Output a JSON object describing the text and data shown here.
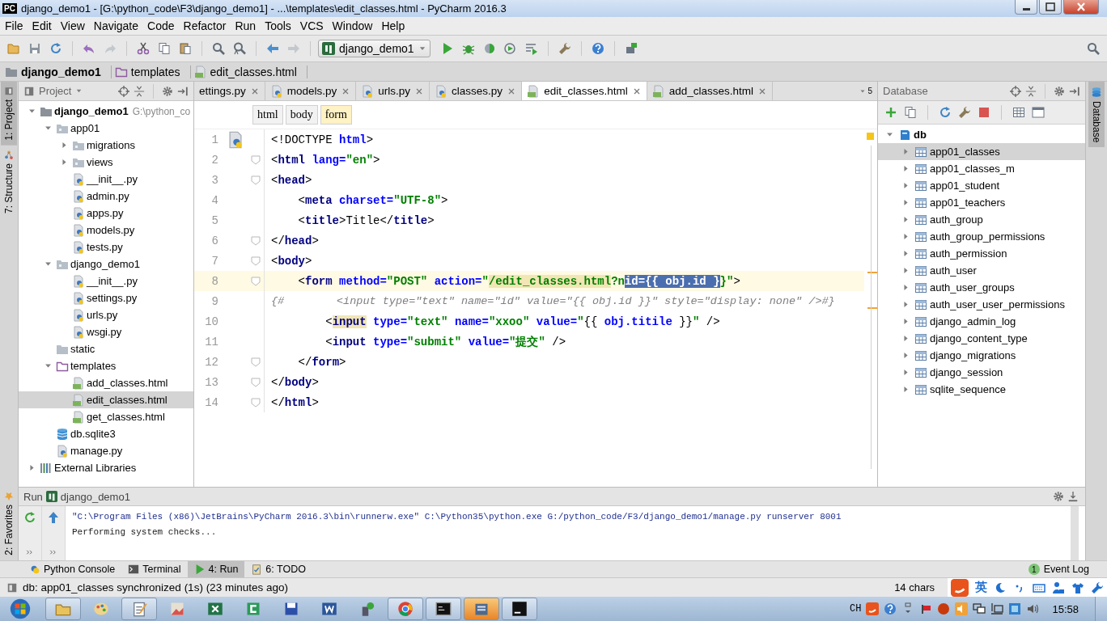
{
  "window": {
    "title": "django_demo1 - [G:\\python_code\\F3\\django_demo1] - ...\\templates\\edit_classes.html - PyCharm 2016.3",
    "app_badge": "PC"
  },
  "menu": [
    "File",
    "Edit",
    "View",
    "Navigate",
    "Code",
    "Refactor",
    "Run",
    "Tools",
    "VCS",
    "Window",
    "Help"
  ],
  "toolbar": {
    "run_config": "django_demo1"
  },
  "breadcrumb": [
    {
      "label": "django_demo1",
      "kind": "project"
    },
    {
      "label": "templates",
      "kind": "tfolder"
    },
    {
      "label": "edit_classes.html",
      "kind": "html"
    }
  ],
  "side_tabs_left": [
    {
      "label": "1: Project",
      "kind": "project",
      "selected": true
    },
    {
      "label": "7: Structure",
      "kind": "structure",
      "selected": false
    }
  ],
  "favorites_tab": "2: Favorites",
  "project_panel": {
    "title": "Project",
    "tree": [
      {
        "label": "django_demo1",
        "kind": "project",
        "path": "G:\\python_co",
        "expanded": true,
        "selected": false,
        "children": [
          {
            "label": "app01",
            "kind": "package",
            "expanded": true,
            "selected": false,
            "children": [
              {
                "label": "migrations",
                "kind": "package",
                "expanded": false,
                "selected": false
              },
              {
                "label": "views",
                "kind": "package",
                "expanded": false,
                "selected": false
              },
              {
                "label": "__init__.py",
                "kind": "python",
                "selected": false
              },
              {
                "label": "admin.py",
                "kind": "python",
                "selected": false
              },
              {
                "label": "apps.py",
                "kind": "python",
                "selected": false
              },
              {
                "label": "models.py",
                "kind": "python",
                "selected": false
              },
              {
                "label": "tests.py",
                "kind": "python",
                "selected": false
              }
            ]
          },
          {
            "label": "django_demo1",
            "kind": "package",
            "expanded": true,
            "selected": false,
            "children": [
              {
                "label": "__init__.py",
                "kind": "python",
                "selected": false
              },
              {
                "label": "settings.py",
                "kind": "python",
                "selected": false
              },
              {
                "label": "urls.py",
                "kind": "python",
                "selected": false
              },
              {
                "label": "wsgi.py",
                "kind": "python",
                "selected": false
              }
            ]
          },
          {
            "label": "static",
            "kind": "folder",
            "selected": false
          },
          {
            "label": "templates",
            "kind": "tfolder",
            "expanded": true,
            "selected": false,
            "children": [
              {
                "label": "add_classes.html",
                "kind": "html",
                "selected": false
              },
              {
                "label": "edit_classes.html",
                "kind": "html",
                "selected": true
              },
              {
                "label": "get_classes.html",
                "kind": "html",
                "selected": false
              }
            ]
          },
          {
            "label": "db.sqlite3",
            "kind": "db",
            "selected": false
          },
          {
            "label": "manage.py",
            "kind": "python",
            "selected": false
          }
        ]
      },
      {
        "label": "External Libraries",
        "kind": "library",
        "expanded": false,
        "selected": false
      }
    ]
  },
  "editor_tabs": [
    {
      "label": "ettings.py",
      "selected": false
    },
    {
      "label": "models.py",
      "kind": "python",
      "selected": false
    },
    {
      "label": "urls.py",
      "kind": "python",
      "selected": false
    },
    {
      "label": "classes.py",
      "kind": "python",
      "selected": false
    },
    {
      "label": "edit_classes.html",
      "kind": "html",
      "selected": true
    },
    {
      "label": "add_classes.html",
      "kind": "html",
      "selected": false
    }
  ],
  "tab_count": "5",
  "tag_path": [
    {
      "label": "html",
      "selected": false
    },
    {
      "label": "body",
      "selected": false
    },
    {
      "label": "form",
      "selected": true
    }
  ],
  "code": [
    {
      "num": "1",
      "kind": "icon",
      "fold": false,
      "current": false,
      "segments": [
        {
          "text": "<!DOCTYPE ",
          "kind": "text"
        },
        {
          "text": "html",
          "kind": "attr"
        },
        {
          "text": ">",
          "kind": "text"
        }
      ]
    },
    {
      "num": "2",
      "fold": true,
      "current": false,
      "segments": [
        {
          "text": "<",
          "kind": "text"
        },
        {
          "text": "html",
          "kind": "tag"
        },
        {
          "text": " lang=",
          "kind": "attr"
        },
        {
          "text": "\"en\"",
          "kind": "str"
        },
        {
          "text": ">",
          "kind": "text"
        }
      ]
    },
    {
      "num": "3",
      "fold": true,
      "current": false,
      "segments": [
        {
          "text": "<",
          "kind": "text"
        },
        {
          "text": "head",
          "kind": "tag"
        },
        {
          "text": ">",
          "kind": "text"
        }
      ]
    },
    {
      "num": "4",
      "fold": false,
      "current": false,
      "segments": [
        {
          "text": "    <",
          "kind": "text"
        },
        {
          "text": "meta",
          "kind": "tag"
        },
        {
          "text": " charset=",
          "kind": "attr"
        },
        {
          "text": "\"UTF-8\"",
          "kind": "str"
        },
        {
          "text": ">",
          "kind": "text"
        }
      ]
    },
    {
      "num": "5",
      "fold": false,
      "current": false,
      "segments": [
        {
          "text": "    <",
          "kind": "text"
        },
        {
          "text": "title",
          "kind": "tag"
        },
        {
          "text": ">Title</",
          "kind": "text"
        },
        {
          "text": "title",
          "kind": "tag"
        },
        {
          "text": ">",
          "kind": "text"
        }
      ]
    },
    {
      "num": "6",
      "fold": true,
      "current": false,
      "segments": [
        {
          "text": "</",
          "kind": "text"
        },
        {
          "text": "head",
          "kind": "tag"
        },
        {
          "text": ">",
          "kind": "text"
        }
      ]
    },
    {
      "num": "7",
      "fold": true,
      "current": false,
      "segments": [
        {
          "text": "<",
          "kind": "text"
        },
        {
          "text": "body",
          "kind": "tag"
        },
        {
          "text": ">",
          "kind": "text"
        }
      ]
    },
    {
      "num": "8",
      "fold": true,
      "current": true,
      "segments": [
        {
          "text": "    <",
          "kind": "text"
        },
        {
          "text": "form",
          "kind": "tag"
        },
        {
          "text": " method=",
          "kind": "attr"
        },
        {
          "text": "\"POST\"",
          "kind": "str"
        },
        {
          "text": " action=",
          "kind": "attr"
        },
        {
          "text": "\"",
          "kind": "str"
        },
        {
          "text": "/edit_classes.html",
          "kind": "str-match"
        },
        {
          "text": "?n",
          "kind": "str"
        },
        {
          "text": "id={{ obj.id }",
          "kind": "selection"
        },
        {
          "text": "}\"",
          "kind": "str"
        },
        {
          "text": ">",
          "kind": "text"
        }
      ]
    },
    {
      "num": "9",
      "fold": false,
      "current": false,
      "segments": [
        {
          "text": "{#        <input type=\"text\" name=\"id\" value=\"{{ obj.id }}\" style=\"display: none\" />#}",
          "kind": "comment"
        }
      ]
    },
    {
      "num": "10",
      "fold": false,
      "current": false,
      "segments": [
        {
          "text": "        <",
          "kind": "text"
        },
        {
          "text": "input",
          "kind": "tag-match"
        },
        {
          "text": " type=",
          "kind": "attr"
        },
        {
          "text": "\"text\"",
          "kind": "str"
        },
        {
          "text": " name=",
          "kind": "attr"
        },
        {
          "text": "\"xxoo\"",
          "kind": "str"
        },
        {
          "text": " value=",
          "kind": "attr"
        },
        {
          "text": "\"",
          "kind": "str"
        },
        {
          "text": "{{ ",
          "kind": "text"
        },
        {
          "text": "obj.titile",
          "kind": "attr"
        },
        {
          "text": " }}",
          "kind": "text"
        },
        {
          "text": "\"",
          "kind": "str"
        },
        {
          "text": " />",
          "kind": "text"
        }
      ]
    },
    {
      "num": "11",
      "fold": false,
      "current": false,
      "segments": [
        {
          "text": "        <",
          "kind": "text"
        },
        {
          "text": "input",
          "kind": "tag"
        },
        {
          "text": " type=",
          "kind": "attr"
        },
        {
          "text": "\"submit\"",
          "kind": "str"
        },
        {
          "text": " value=",
          "kind": "attr"
        },
        {
          "text": "\"提交\"",
          "kind": "str"
        },
        {
          "text": " />",
          "kind": "text"
        }
      ]
    },
    {
      "num": "12",
      "fold": true,
      "current": false,
      "segments": [
        {
          "text": "    </",
          "kind": "text"
        },
        {
          "text": "form",
          "kind": "tag"
        },
        {
          "text": ">",
          "kind": "text"
        }
      ]
    },
    {
      "num": "13",
      "fold": true,
      "current": false,
      "segments": [
        {
          "text": "</",
          "kind": "text"
        },
        {
          "text": "body",
          "kind": "tag"
        },
        {
          "text": ">",
          "kind": "text"
        }
      ]
    },
    {
      "num": "14",
      "fold": true,
      "current": false,
      "segments": [
        {
          "text": "</",
          "kind": "text"
        },
        {
          "text": "html",
          "kind": "tag"
        },
        {
          "text": ">",
          "kind": "text"
        }
      ]
    }
  ],
  "database_panel": {
    "title": "Database",
    "tree": [
      {
        "label": "db",
        "kind": "dbsource",
        "expanded": true,
        "selected": false,
        "children": [
          {
            "label": "app01_classes",
            "kind": "table",
            "expanded": false,
            "selected": true
          },
          {
            "label": "app01_classes_m",
            "kind": "table",
            "expanded": false,
            "selected": false
          },
          {
            "label": "app01_student",
            "kind": "table",
            "expanded": false,
            "selected": false
          },
          {
            "label": "app01_teachers",
            "kind": "table",
            "expanded": false,
            "selected": false
          },
          {
            "label": "auth_group",
            "kind": "table",
            "expanded": false,
            "selected": false
          },
          {
            "label": "auth_group_permissions",
            "kind": "table",
            "expanded": false,
            "selected": false
          },
          {
            "label": "auth_permission",
            "kind": "table",
            "expanded": false,
            "selected": false
          },
          {
            "label": "auth_user",
            "kind": "table",
            "expanded": false,
            "selected": false
          },
          {
            "label": "auth_user_groups",
            "kind": "table",
            "expanded": false,
            "selected": false
          },
          {
            "label": "auth_user_user_permissions",
            "kind": "table",
            "expanded": false,
            "selected": false
          },
          {
            "label": "django_admin_log",
            "kind": "table",
            "expanded": false,
            "selected": false
          },
          {
            "label": "django_content_type",
            "kind": "table",
            "expanded": false,
            "selected": false
          },
          {
            "label": "django_migrations",
            "kind": "table",
            "expanded": false,
            "selected": false
          },
          {
            "label": "django_session",
            "kind": "table",
            "expanded": false,
            "selected": false
          },
          {
            "label": "sqlite_sequence",
            "kind": "table",
            "expanded": false,
            "selected": false
          }
        ]
      }
    ]
  },
  "side_tabs_right": [
    {
      "label": "Database",
      "selected": true
    }
  ],
  "run_panel": {
    "title": "Run",
    "config": "django_demo1",
    "output": [
      {
        "text": "\"C:\\Program Files (x86)\\JetBrains\\PyCharm 2016.3\\bin\\runnerw.exe\" C:\\Python35\\python.exe G:/python_code/F3/django_demo1/manage.py runserver 8001",
        "kind": "command"
      },
      {
        "text": "Performing system checks...",
        "kind": "info"
      }
    ]
  },
  "tool_tabs": [
    {
      "label": "Python Console",
      "kind": "pyconsole",
      "selected": false
    },
    {
      "label": "Terminal",
      "kind": "terminal",
      "selected": false
    },
    {
      "label": "4: Run",
      "kind": "run",
      "selected": true
    },
    {
      "label": "6: TODO",
      "kind": "todo",
      "selected": false
    }
  ],
  "event_log": {
    "label": "Event Log",
    "count": "1"
  },
  "status_bar": {
    "message": "db: app01_classes synchronized (1s) (23 minutes ago)",
    "chars": "14 chars"
  },
  "ime": {
    "mode": "英"
  },
  "taskbar": {
    "apps": [
      {
        "kind": "explorer",
        "running": true,
        "highlighted": false
      },
      {
        "kind": "paint",
        "running": false,
        "highlighted": false
      },
      {
        "kind": "notepad",
        "running": true,
        "highlighted": false
      },
      {
        "kind": "image",
        "running": false,
        "highlighted": false
      },
      {
        "kind": "sheet",
        "running": false,
        "highlighted": false
      },
      {
        "kind": "green",
        "running": false,
        "highlighted": false
      },
      {
        "kind": "floppy",
        "running": false,
        "highlighted": false
      },
      {
        "kind": "doc",
        "running": false,
        "highlighted": false
      },
      {
        "kind": "tool",
        "running": false,
        "highlighted": false
      },
      {
        "kind": "chrome",
        "running": true,
        "highlighted": false
      },
      {
        "kind": "cmd",
        "running": true,
        "highlighted": false
      },
      {
        "kind": "box",
        "running": true,
        "highlighted": true
      },
      {
        "kind": "ide",
        "running": true,
        "highlighted": false
      }
    ],
    "lang": "CH",
    "clock": "15:58"
  }
}
